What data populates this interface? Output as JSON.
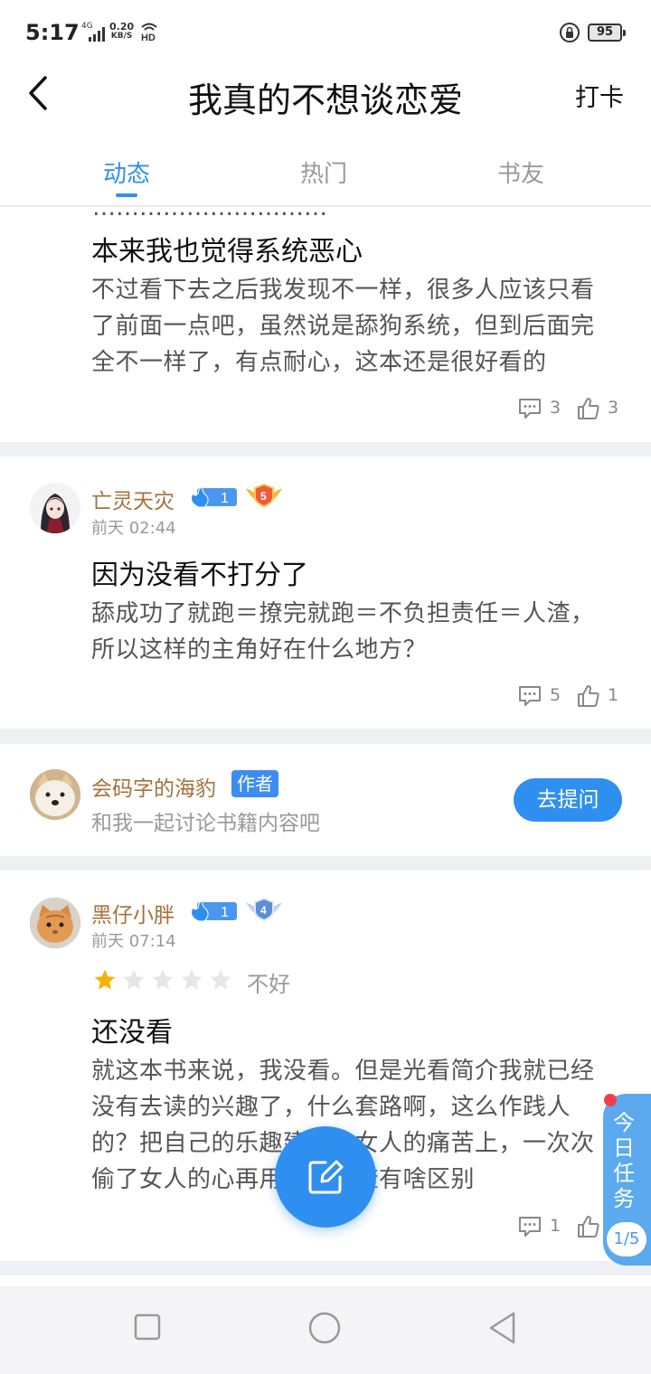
{
  "status_bar": {
    "time": "5:17",
    "network_type": "4G",
    "speed_value": "0.20",
    "speed_unit": "KB/S",
    "hd": "HD",
    "battery": "95"
  },
  "header": {
    "title": "我真的不想谈恋爱",
    "checkin_label": "打卡"
  },
  "tabs": [
    {
      "label": "动态",
      "active": true
    },
    {
      "label": "热门",
      "active": false
    },
    {
      "label": "书友",
      "active": false
    }
  ],
  "posts": [
    {
      "cut_text": "…………………………",
      "title": "本来我也觉得系统恶心",
      "body_lines": [
        "不过看下去之后我发现不一样，很多人应该只看",
        "了前面一点吧，虽然说是舔狗系统，但到后面完",
        "全不一样了，有点耐心，这本还是很好看的"
      ],
      "comments": "3",
      "likes": "3"
    },
    {
      "user": "亡灵天灾",
      "time": "前天 02:44",
      "fan_level": "1",
      "rank_level": "5",
      "title": "因为没看不打分了",
      "body_lines": [
        "舔成功了就跑＝撩完就跑＝不负担责任＝人渣，",
        "所以这样的主角好在什么地方？"
      ],
      "comments": "5",
      "likes": "1"
    },
    {
      "user": "黑仔小胖",
      "time": "前天 07:14",
      "fan_level": "1",
      "rank_level": "4",
      "rating": 1,
      "rating_max": 5,
      "rating_label": "不好",
      "title": "还没看",
      "body_lines": [
        "就这本书来说，我没看。但是光看简介我就已经",
        "没有去读的兴趣了，什么套路啊，这么作践人",
        "的？把自己的乐趣建立在女人的痛苦上，一次次",
        "偷了女人的心再用，跟人渣有啥区别"
      ],
      "comments": "1",
      "likes": ""
    }
  ],
  "author_card": {
    "name": "会码字的海豹",
    "tag": "作者",
    "desc": "和我一起讨论书籍内容吧",
    "button": "去提问"
  },
  "floating": {
    "task_title": "今日任务",
    "task_progress": "1/5"
  },
  "colors": {
    "accent": "#2f8ff0",
    "username": "#a4703c",
    "star": "#f5b301"
  }
}
